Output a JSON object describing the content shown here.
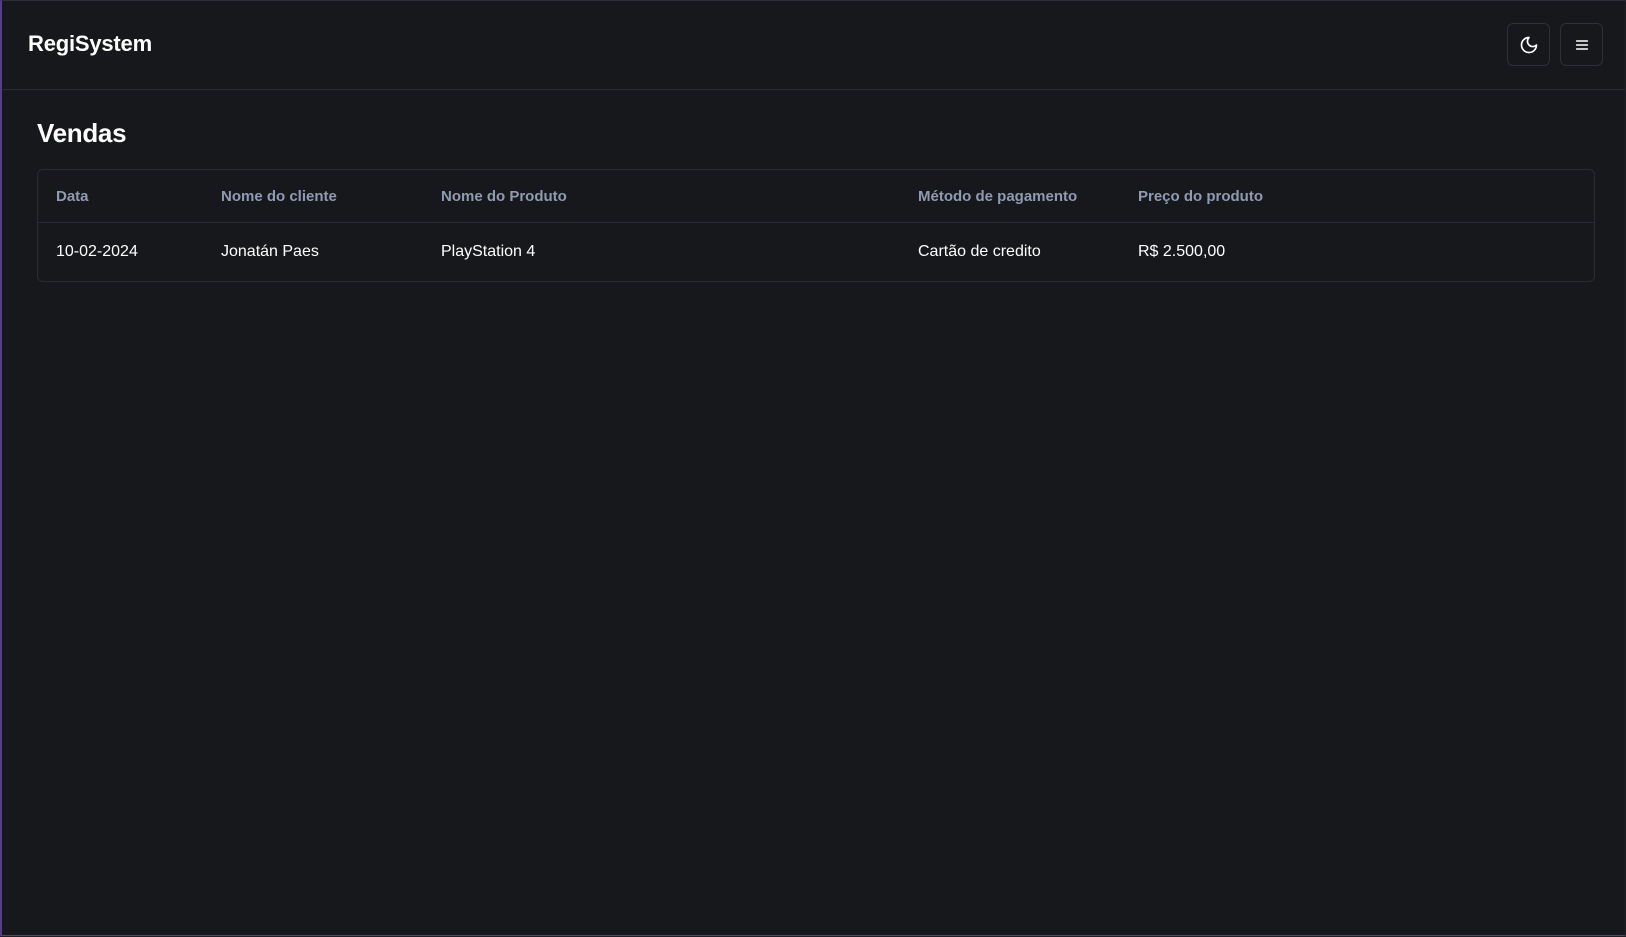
{
  "header": {
    "brand": "RegiSystem",
    "theme_icon": "moon-icon",
    "menu_icon": "hamburger-menu-icon"
  },
  "main": {
    "title": "Vendas",
    "table": {
      "columns": [
        "Data",
        "Nome do cliente",
        "Nome do Produto",
        "Método de pagamento",
        "Preço do produto"
      ],
      "rows": [
        [
          "10-02-2024",
          "Jonatán Paes",
          "PlayStation 4",
          "Cartão de credito",
          "R$ 2.500,00"
        ]
      ]
    }
  },
  "colors": {
    "background": "#17181c",
    "header_text": "#8f9bb3",
    "text": "#ffffff",
    "border": "#2a2c33"
  }
}
